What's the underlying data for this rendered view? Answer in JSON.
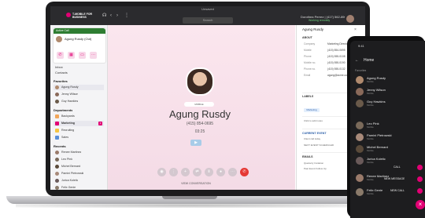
{
  "window": {
    "title": "Unsaved"
  },
  "app": {
    "brand": "T-MOBILE FOR BUSINESS",
    "search_placeholder": "Search"
  },
  "user": {
    "name": "Dorothea Perrez | (417) 562-8901",
    "status": "Working remotely"
  },
  "sidebar": {
    "active_call": {
      "header": "Active Call",
      "name": "Agung Rusdy (Out)"
    },
    "links": [
      "Inbox",
      "Contacts"
    ],
    "favorites_title": "Favorites",
    "favorites": [
      "Agung Rusdy",
      "Jenny Wilson",
      "Guy Hawkins"
    ],
    "departments_title": "Departments",
    "departments": [
      "Backyards",
      "Marketing",
      "Recruiting",
      "Sales"
    ],
    "recents_title": "Recents",
    "recents": [
      "Renee Martinez",
      "Leo Pink",
      "Michel Bernard",
      "Pamini Pietrowski",
      "Jurica Koletic",
      "Felix Genie"
    ],
    "marketing_badge": "3"
  },
  "call": {
    "chip": "MOBILE",
    "name": "Agung Rusdy",
    "phone": "(415) 854-0695",
    "timer": "03:25",
    "view_conversation": "VIEW CONVERSATION"
  },
  "contact_panel": {
    "title": "Agung Rusdy",
    "about_title": "ABOUT",
    "fields": [
      {
        "k": "Company",
        "v": "Marketing Director"
      },
      {
        "k": "Mobile",
        "v": "(415) 854-0695"
      },
      {
        "k": "Phone",
        "v": "(415) 555-0108"
      },
      {
        "k": "Mobile no.",
        "v": "(415) 555-0190"
      },
      {
        "k": "Phone no.",
        "v": "(415) 555-0132"
      },
      {
        "k": "Email",
        "v": "agung@acme.com"
      }
    ],
    "labels_title": "LABELS",
    "label_chip": "Marketing",
    "add_note": "Click to add notes",
    "current_event_title": "CURRENT EVENT",
    "current_event": "Client call today",
    "next_event_title": "NEXT EVENT SCHEDULED",
    "emails_title": "EMAILS",
    "emails": [
      "Quarterly Invitation",
      "Past Event Follow Up"
    ]
  },
  "phone": {
    "time": "9:41",
    "title": "Home",
    "section": "Favorites",
    "contacts": [
      {
        "name": "Agung Rusdy",
        "sub": "Mobile"
      },
      {
        "name": "Jenny Wilson",
        "sub": "Mobile"
      },
      {
        "name": "Guy Hawkins",
        "sub": "Mobile"
      },
      {
        "name": "Leo Pink",
        "sub": "Mobile"
      },
      {
        "name": "Pamini Pietrowski",
        "sub": "Mobile"
      },
      {
        "name": "Michel Bernard",
        "sub": "Mobile"
      },
      {
        "name": "Jurica Koletic",
        "sub": "Mobile"
      },
      {
        "name": "Renee Martinez",
        "sub": "Mobile"
      },
      {
        "name": "Felix Genie",
        "sub": "Mobile"
      }
    ],
    "speed_dial": [
      "CALL",
      "NEW MESSAGE",
      "NEW CALL"
    ]
  },
  "colors": {
    "accent": "#e20074",
    "call_bg": "#fbe6ee",
    "active_green": "#2e7d32",
    "end_call": "#e53935"
  }
}
